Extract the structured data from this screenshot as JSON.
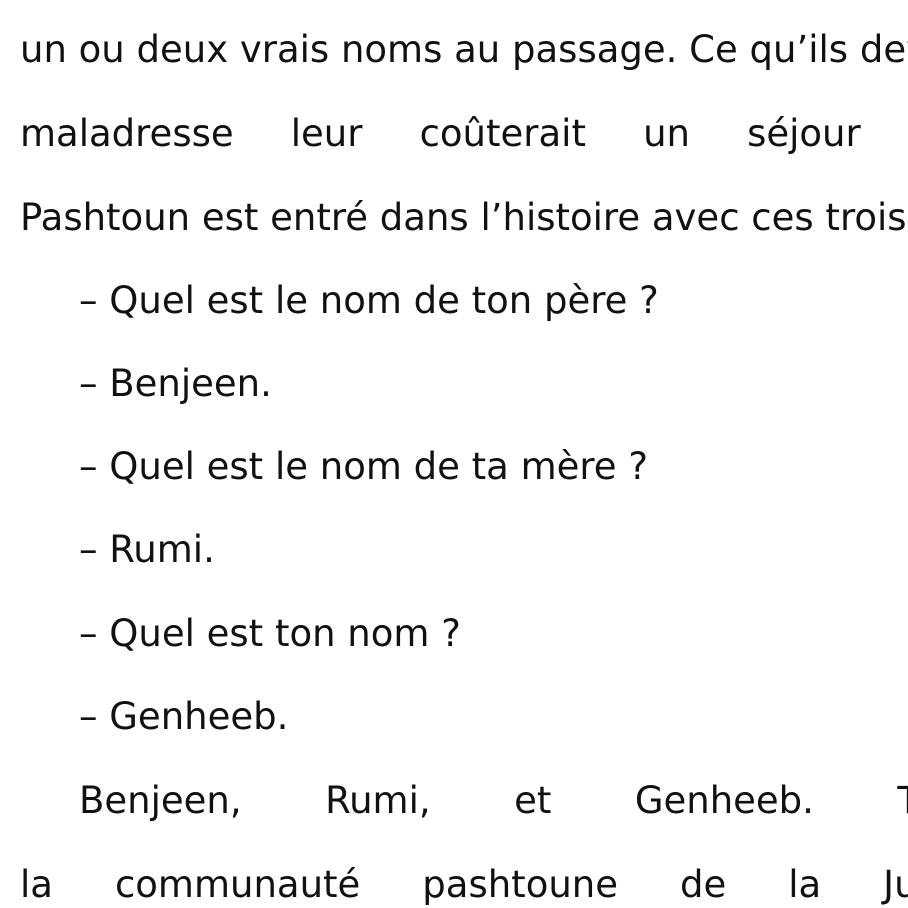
{
  "document": {
    "lines": [
      "un ou deux vrais noms au passage. Ce qu’ils dev",
      "maladresse leur coûterait un séjour en centre d",
      "Pashtoun est entré dans l’histoire avec ces trois n",
      "– Quel est le nom de ton père ?",
      "– Benjeen.",
      "– Quel est le nom de ta mère ?",
      "– Rumi.",
      "– Quel est ton nom ?",
      "– Genheeb.",
      "Benjeen, Rumi, et Genheeb. Trois noms si",
      "la communauté pashtoune de la Jungle les ad"
    ]
  }
}
